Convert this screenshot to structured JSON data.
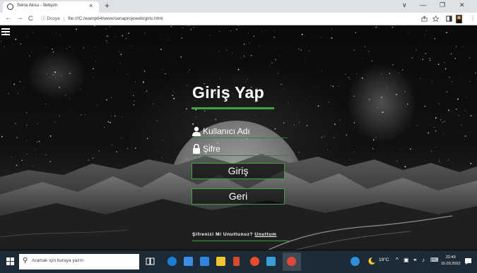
{
  "browser": {
    "tab_title": "Sena Aksu - İletişim",
    "tab_close": "×",
    "new_tab": "+",
    "window_controls": [
      "∨",
      "—",
      "❐",
      "✕"
    ],
    "nav": {
      "back": "←",
      "forward": "→",
      "reload": "C"
    },
    "address": {
      "info_icon": "ⓘ",
      "scheme_label": "Dosya",
      "separator": "|",
      "url": "file:///C:/wamp64/www/senaprojeweb/giris.html"
    },
    "toolbar_icons": [
      "share-icon",
      "star-icon",
      "sidebar-icon",
      "profile-icon",
      "menu-icon"
    ]
  },
  "login": {
    "title": "Giriş Yap",
    "username_placeholder": "Kullanıcı Adı",
    "password_placeholder": "Şifre",
    "login_button": "Giriş",
    "back_button": "Geri",
    "forgot_text": "Şifrenizi Mi Unuttunuz?",
    "forgot_link": "Unuttum"
  },
  "taskbar": {
    "search_placeholder": "Aramak için buraya yazın",
    "weather": "19°C",
    "tray_arrow": "^",
    "time": "22:49",
    "date": "15.03.2022"
  },
  "colors": {
    "accent_green": "#3fa53f",
    "taskbar": "#1c2b36",
    "tabstrip": "#dee1e6"
  }
}
